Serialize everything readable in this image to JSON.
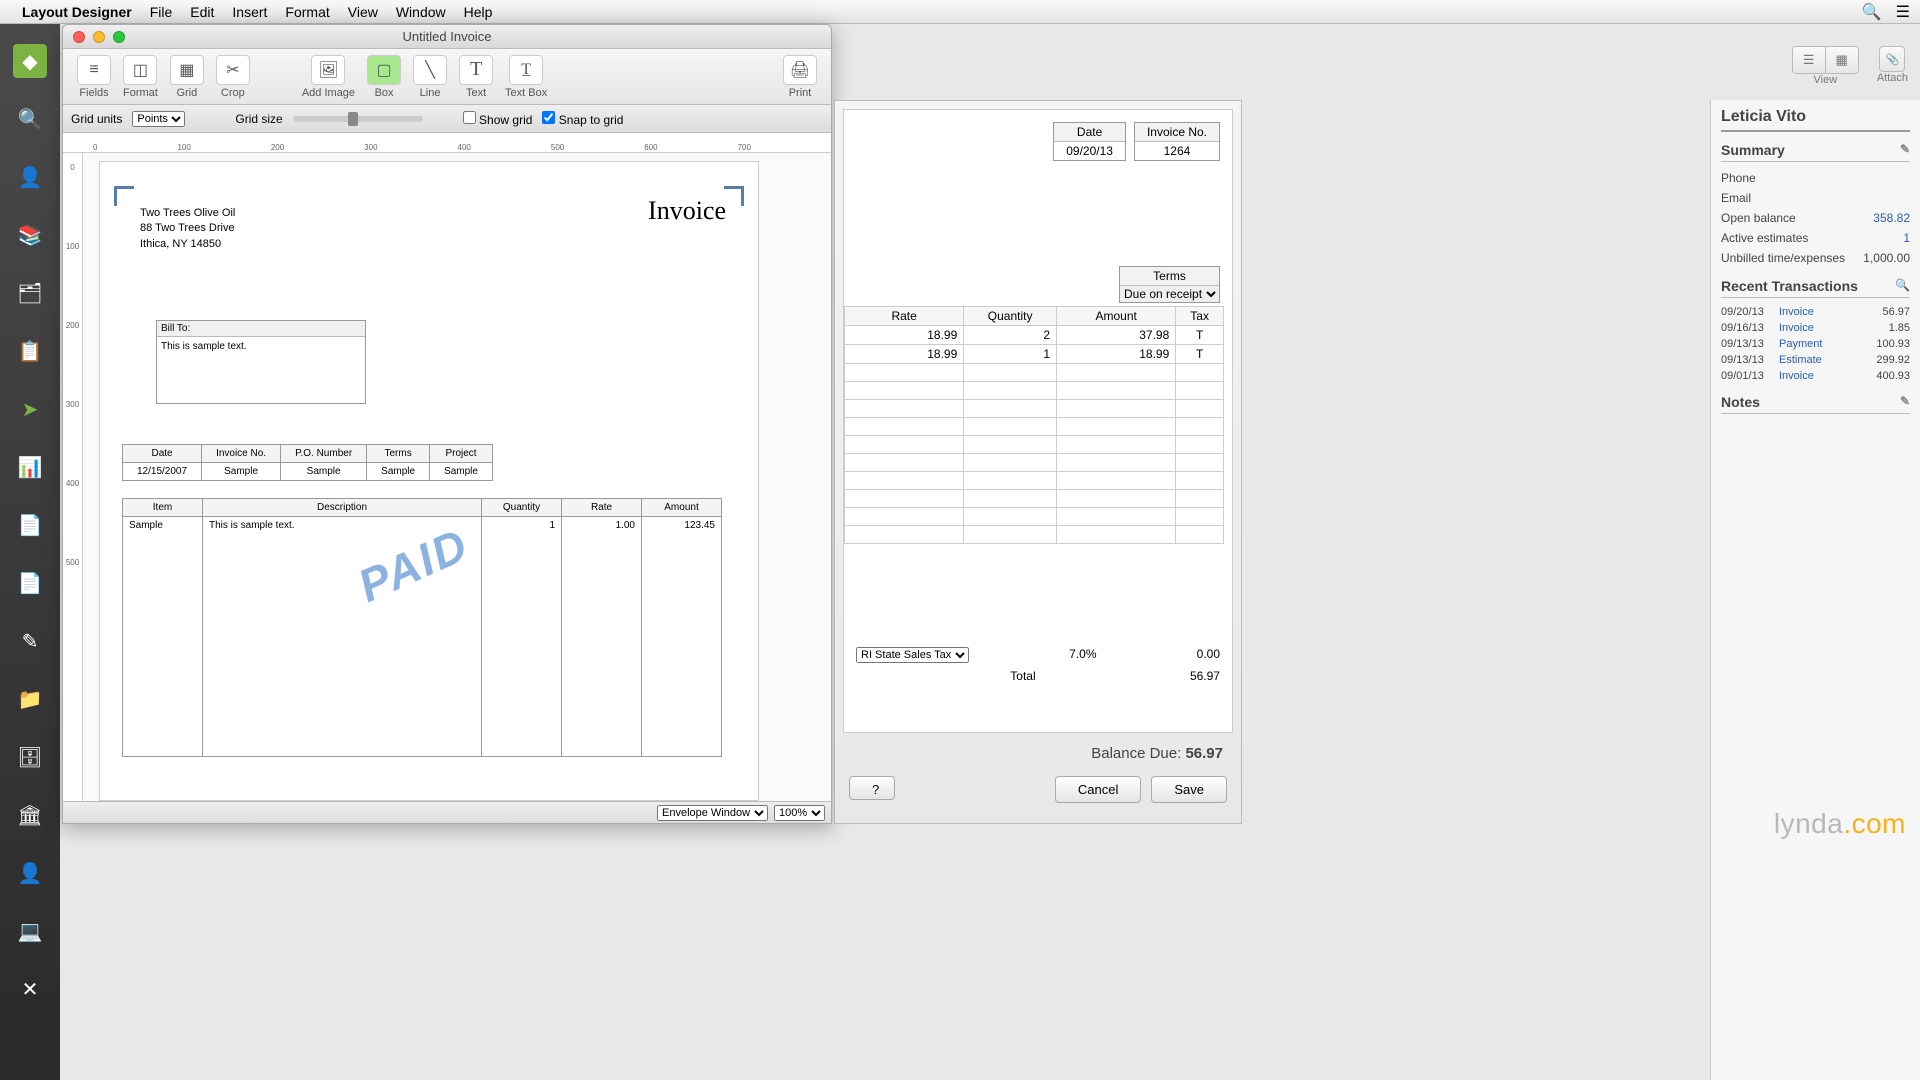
{
  "menubar": {
    "app": "Layout Designer",
    "items": [
      "File",
      "Edit",
      "Insert",
      "Format",
      "View",
      "Window",
      "Help"
    ]
  },
  "window": {
    "title": "Untitled Invoice",
    "toolbar": {
      "fields": "Fields",
      "format": "Format",
      "grid": "Grid",
      "crop": "Crop",
      "add_image": "Add Image",
      "box": "Box",
      "line": "Line",
      "text": "Text",
      "text_box": "Text Box",
      "print": "Print"
    },
    "options": {
      "grid_units_label": "Grid units",
      "grid_units_value": "Points",
      "grid_size_label": "Grid size",
      "show_grid": "Show grid",
      "snap_to_grid": "Snap to grid"
    },
    "ruler_h": [
      "0",
      "100",
      "200",
      "300",
      "400",
      "500",
      "600",
      "700"
    ],
    "ruler_v": [
      "0",
      "100",
      "200",
      "300",
      "400",
      "500"
    ],
    "bottom": {
      "envelope": "Envelope Window",
      "zoom": "100%"
    }
  },
  "invoice_layout": {
    "company": {
      "name": "Two Trees Olive Oil",
      "addr1": "88 Two Trees Drive",
      "addr2": "Ithica, NY 14850"
    },
    "title": "Invoice",
    "billto": {
      "label": "Bill To:",
      "body": "This is sample text."
    },
    "meta": {
      "headers": [
        "Date",
        "Invoice No.",
        "P.O. Number",
        "Terms",
        "Project"
      ],
      "row": [
        "12/15/2007",
        "Sample",
        "Sample",
        "Sample",
        "Sample"
      ]
    },
    "items": {
      "headers": [
        "Item",
        "Description",
        "Quantity",
        "Rate",
        "Amount"
      ],
      "row": [
        "Sample",
        "This is sample text.",
        "1",
        "1.00",
        "123.45"
      ]
    },
    "paid": "PAID"
  },
  "back_invoice": {
    "date": {
      "label": "Date",
      "value": "09/20/13"
    },
    "invno": {
      "label": "Invoice No.",
      "value": "1264"
    },
    "terms": {
      "label": "Terms",
      "value": "Due on receipt"
    },
    "cols": [
      "Rate",
      "Quantity",
      "Amount",
      "Tax"
    ],
    "rows": [
      {
        "rate": "18.99",
        "qty": "2",
        "amt": "37.98",
        "tax": "T"
      },
      {
        "rate": "18.99",
        "qty": "1",
        "amt": "18.99",
        "tax": "T"
      }
    ],
    "tax_item": "RI State Sales Tax",
    "tax_rate": "7.0%",
    "tax_amount": "0.00",
    "total_label": "Total",
    "total": "56.97",
    "balance_label": "Balance Due:",
    "balance": "56.97",
    "cancel": "Cancel",
    "save": "Save"
  },
  "customer": {
    "name": "Leticia Vito",
    "summary_title": "Summary",
    "phone_label": "Phone",
    "email_label": "Email",
    "open_balance_label": "Open balance",
    "open_balance": "358.82",
    "active_est_label": "Active estimates",
    "active_est": "1",
    "unbilled_label": "Unbilled time/expenses",
    "unbilled": "1,000.00",
    "recent_title": "Recent Transactions",
    "transactions": [
      {
        "date": "09/20/13",
        "type": "Invoice",
        "amt": "56.97"
      },
      {
        "date": "09/16/13",
        "type": "Invoice",
        "amt": "1.85"
      },
      {
        "date": "09/13/13",
        "type": "Payment",
        "amt": "100.93"
      },
      {
        "date": "09/13/13",
        "type": "Estimate",
        "amt": "299.92"
      },
      {
        "date": "09/01/13",
        "type": "Invoice",
        "amt": "400.93"
      }
    ],
    "notes_title": "Notes"
  },
  "top_right": {
    "view": "View",
    "attach": "Attach"
  },
  "watermark": {
    "a": "lynda",
    "b": ".com"
  }
}
